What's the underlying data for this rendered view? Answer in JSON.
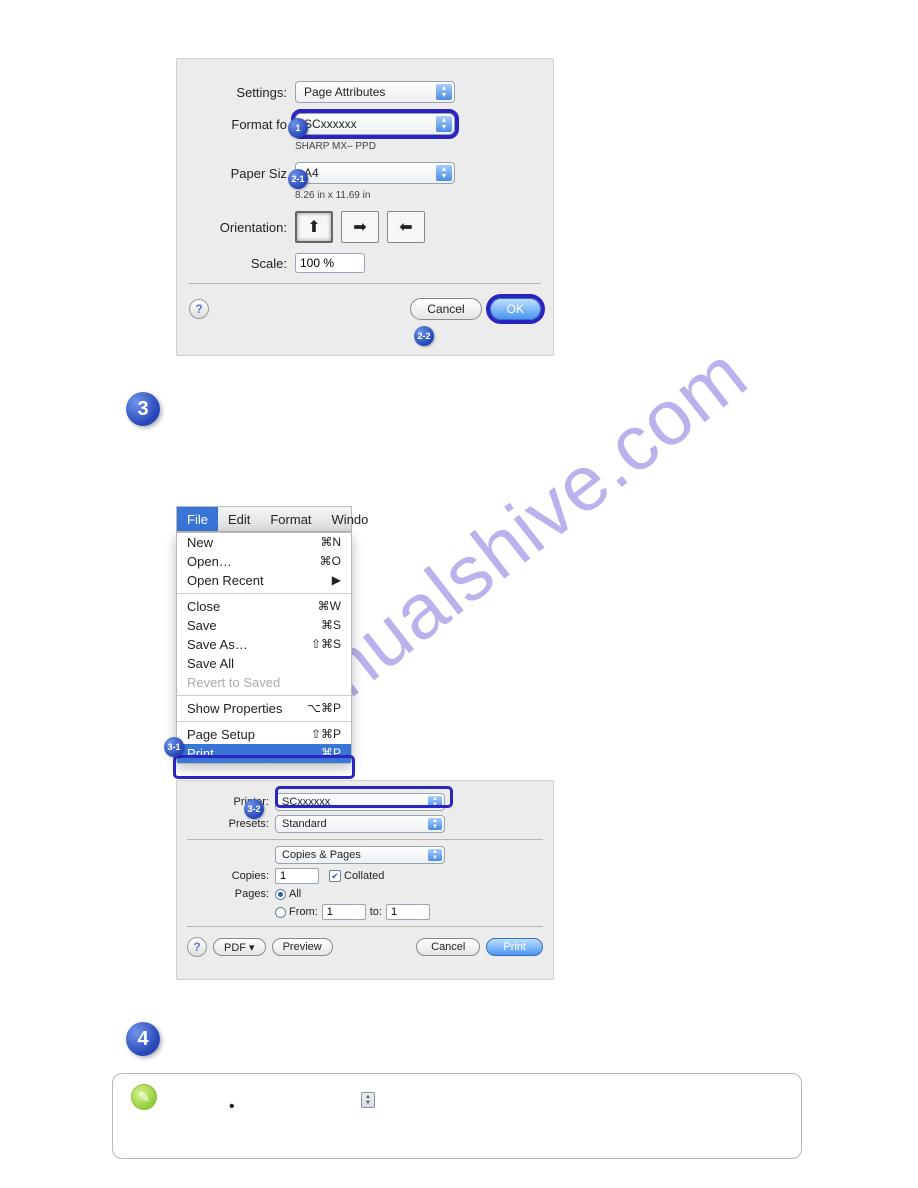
{
  "watermark": "manualshive.com",
  "page_setup": {
    "settings_label": "Settings:",
    "settings_value": "Page Attributes",
    "format_label": "Format fo",
    "format_value": "SCxxxxxx",
    "driver_text": "SHARP MX–       PPD",
    "paper_label": "Paper Siz",
    "paper_value": "A4",
    "paper_dim": "8.26 in x 11.69 in",
    "orientation_label": "Orientation:",
    "scale_label": "Scale:",
    "scale_value": "100 %",
    "cancel": "Cancel",
    "ok": "OK"
  },
  "menus": {
    "file": "File",
    "edit": "Edit",
    "format": "Format",
    "window": "Windo"
  },
  "file_menu": {
    "new": "New",
    "new_sc": "⌘N",
    "open": "Open…",
    "open_sc": "⌘O",
    "open_recent": "Open Recent",
    "open_recent_sc": "▶",
    "close": "Close",
    "close_sc": "⌘W",
    "save": "Save",
    "save_sc": "⌘S",
    "save_as": "Save As…",
    "save_as_sc": "⇧⌘S",
    "save_all": "Save All",
    "revert": "Revert to Saved",
    "show_props": "Show Properties",
    "show_props_sc": "⌥⌘P",
    "page_setup": "Page Setup",
    "page_setup_sc": "⇧⌘P",
    "print": "Print…",
    "print_sc": "⌘P"
  },
  "print_dialog": {
    "printer_label": "Printer:",
    "printer_value": "SCxxxxxx",
    "presets_label": "Presets:",
    "presets_value": "Standard",
    "pane_value": "Copies & Pages",
    "copies_label": "Copies:",
    "copies_value": "1",
    "collated": "Collated",
    "pages_label": "Pages:",
    "all": "All",
    "from": "From:",
    "from_v": "1",
    "to": "to:",
    "to_v": "1",
    "pdf": "PDF ▾",
    "preview": "Preview",
    "cancel": "Cancel",
    "print": "Print"
  },
  "steps": {
    "s3": "3",
    "s4": "4"
  },
  "mini": {
    "m1": "1",
    "m21": "2-1",
    "m22": "2-2",
    "m31": "3-1",
    "m32": "3-2"
  }
}
